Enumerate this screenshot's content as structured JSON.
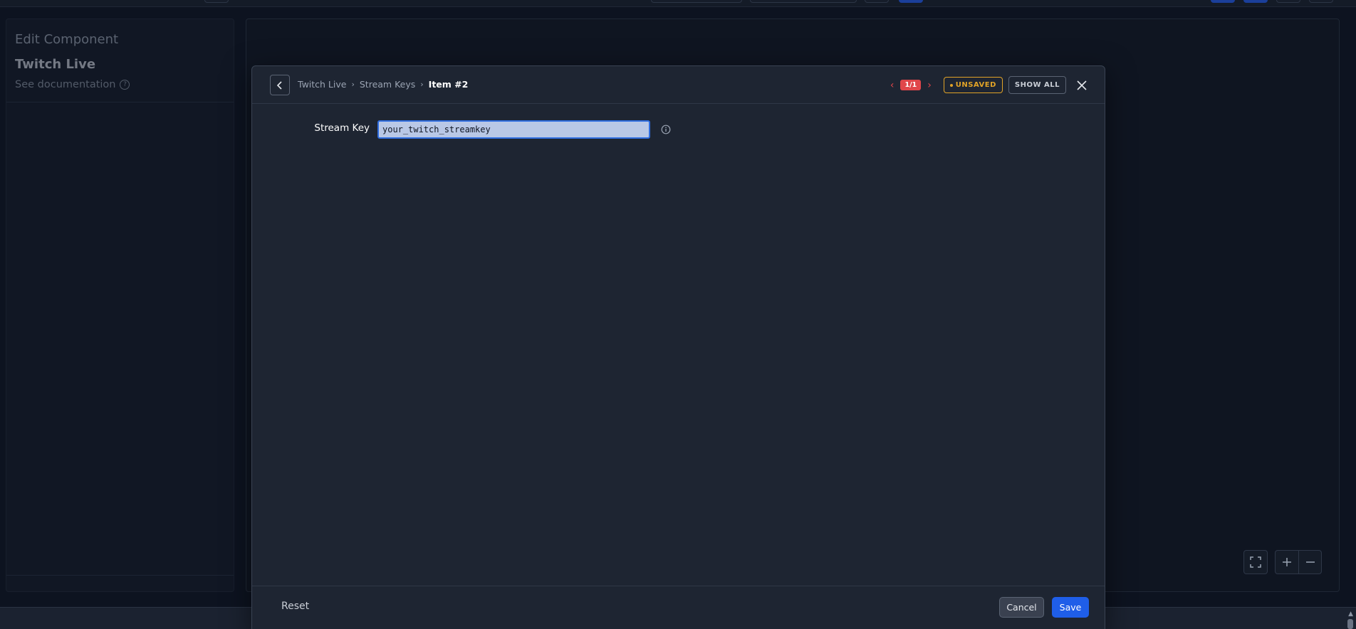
{
  "sidebar": {
    "heading": "Edit Component",
    "component_name": "Twitch Live",
    "doc_link": "See documentation"
  },
  "modal": {
    "breadcrumb": [
      {
        "label": "Twitch Live"
      },
      {
        "label": "Stream Keys"
      },
      {
        "label": "Item #2"
      }
    ],
    "pager_count": "1/1",
    "unsaved_label": "UNSAVED",
    "show_all_label": "SHOW ALL",
    "field": {
      "label": "Stream Key",
      "value": "your_twitch_streamkey"
    },
    "footer": {
      "reset_label": "Reset",
      "cancel_label": "Cancel",
      "save_label": "Save"
    }
  },
  "colors": {
    "accent": "#1f5ee8",
    "unsaved": "#e1a327",
    "pager": "#e0464a",
    "background": "#0d1320",
    "modal": "#1e2532"
  }
}
